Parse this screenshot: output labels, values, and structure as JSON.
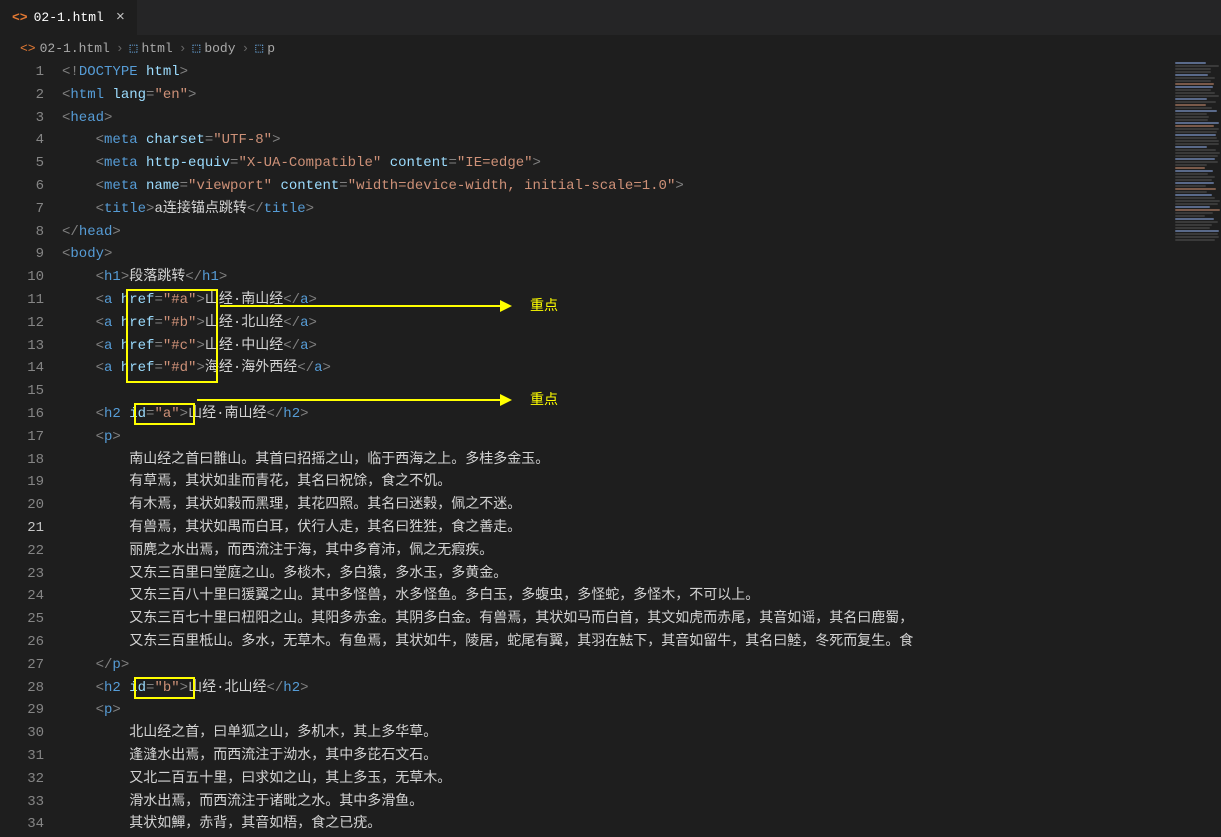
{
  "tab": {
    "filename": "02-1.html"
  },
  "breadcrumb": {
    "file": "02-1.html",
    "parts": [
      "html",
      "body",
      "p"
    ]
  },
  "annotations": {
    "label1": "重点",
    "label2": "重点"
  },
  "code_data": {
    "doctype": "<!DOCTYPE html>",
    "html_attrs": {
      "lang": "en"
    },
    "head": {
      "metas": [
        {
          "charset": "UTF-8"
        },
        {
          "http-equiv": "X-UA-Compatible",
          "content": "IE=edge"
        },
        {
          "name": "viewport",
          "content": "width=device-width, initial-scale=1.0"
        }
      ],
      "title": "a连接锚点跳转"
    },
    "body": {
      "h1": "段落跳转",
      "links": [
        {
          "href": "#a",
          "text": "山经·南山经"
        },
        {
          "href": "#b",
          "text": "山经·北山经"
        },
        {
          "href": "#c",
          "text": "山经·中山经"
        },
        {
          "href": "#d",
          "text": "海经·海外西经"
        }
      ],
      "sections": [
        {
          "id": "a",
          "h2": "山经·南山经",
          "p_lines": [
            "南山经之首曰䧿山。其首曰招摇之山，临于西海之上。多桂多金玉。",
            "有草焉，其状如韭而青花，其名曰祝馀，食之不饥。",
            "有木焉，其状如榖而黑理，其花四照。其名曰迷榖，佩之不迷。",
            "有兽焉，其状如禺而白耳，伏行人走，其名曰狌狌，食之善走。",
            "丽麂之水出焉，而西流注于海，其中多育沛，佩之无瘕疾。",
            "又东三百里曰堂庭之山。多棪木，多白猿，多水玉，多黄金。",
            "又东三百八十里曰猨翼之山。其中多怪兽，水多怪鱼。多白玉，多蝮虫，多怪蛇，多怪木，不可以上。",
            "又东三百七十里曰杻阳之山。其阳多赤金。其阴多白金。有兽焉，其状如马而白首，其文如虎而赤尾，其音如谣，其名曰鹿蜀，",
            "又东三百里柢山。多水，无草木。有鱼焉，其状如牛，陵居，蛇尾有翼，其羽在魼下，其音如留牛，其名曰鯥，冬死而复生。食"
          ]
        },
        {
          "id": "b",
          "h2": "山经·北山经",
          "p_lines": [
            "北山经之首，曰单狐之山，多机木，其上多华草。",
            "逢漨水出焉，而西流注于泑水，其中多芘石文石。",
            "又北二百五十里，曰求如之山，其上多玉，无草木。",
            "滑水出焉，而西流注于诸毗之水。其中多滑鱼。",
            "其状如鱓，赤背，其音如梧，食之已疣。"
          ]
        }
      ]
    }
  },
  "lines": [
    {
      "n": 1,
      "html": "<span class='t-gray'>&lt;!</span><span class='t-doc'>DOCTYPE</span> <span class='t-lblue'>html</span><span class='t-gray'>&gt;</span>"
    },
    {
      "n": 2,
      "html": "<span class='t-gray'>&lt;</span><span class='t-blue'>html</span> <span class='t-lblue'>lang</span><span class='t-gray'>=</span><span class='t-str'>\"en\"</span><span class='t-gray'>&gt;</span>"
    },
    {
      "n": 3,
      "html": "<span class='t-gray'>&lt;</span><span class='t-blue'>head</span><span class='t-gray'>&gt;</span>"
    },
    {
      "n": 4,
      "html": "    <span class='t-gray'>&lt;</span><span class='t-blue'>meta</span> <span class='t-lblue'>charset</span><span class='t-gray'>=</span><span class='t-str'>\"UTF-8\"</span><span class='t-gray'>&gt;</span>"
    },
    {
      "n": 5,
      "html": "    <span class='t-gray'>&lt;</span><span class='t-blue'>meta</span> <span class='t-lblue'>http-equiv</span><span class='t-gray'>=</span><span class='t-str'>\"X-UA-Compatible\"</span> <span class='t-lblue'>content</span><span class='t-gray'>=</span><span class='t-str'>\"IE=edge\"</span><span class='t-gray'>&gt;</span>"
    },
    {
      "n": 6,
      "html": "    <span class='t-gray'>&lt;</span><span class='t-blue'>meta</span> <span class='t-lblue'>name</span><span class='t-gray'>=</span><span class='t-str'>\"viewport\"</span> <span class='t-lblue'>content</span><span class='t-gray'>=</span><span class='t-str'>\"width=device-width, initial-scale=1.0\"</span><span class='t-gray'>&gt;</span>"
    },
    {
      "n": 7,
      "html": "    <span class='t-gray'>&lt;</span><span class='t-blue'>title</span><span class='t-gray'>&gt;</span><span class='t-txt'>a连接锚点跳转</span><span class='t-gray'>&lt;/</span><span class='t-blue'>title</span><span class='t-gray'>&gt;</span>"
    },
    {
      "n": 8,
      "html": "<span class='t-gray'>&lt;/</span><span class='t-blue'>head</span><span class='t-gray'>&gt;</span>"
    },
    {
      "n": 9,
      "html": "<span class='t-gray'>&lt;</span><span class='t-blue'>body</span><span class='t-gray'>&gt;</span>"
    },
    {
      "n": 10,
      "html": "    <span class='t-gray'>&lt;</span><span class='t-blue'>h1</span><span class='t-gray'>&gt;</span><span class='t-txt'>段落跳转</span><span class='t-gray'>&lt;/</span><span class='t-blue'>h1</span><span class='t-gray'>&gt;</span>"
    },
    {
      "n": 11,
      "html": "    <span class='t-gray'>&lt;</span><span class='t-blue'>a</span> <span class='t-lblue'>href</span><span class='t-gray'>=</span><span class='t-str'>\"#a\"</span><span class='t-gray'>&gt;</span><span class='t-txt'>山经·南山经</span><span class='t-gray'>&lt;/</span><span class='t-blue'>a</span><span class='t-gray'>&gt;</span>"
    },
    {
      "n": 12,
      "html": "    <span class='t-gray'>&lt;</span><span class='t-blue'>a</span> <span class='t-lblue'>href</span><span class='t-gray'>=</span><span class='t-str'>\"#b\"</span><span class='t-gray'>&gt;</span><span class='t-txt'>山经·北山经</span><span class='t-gray'>&lt;/</span><span class='t-blue'>a</span><span class='t-gray'>&gt;</span>"
    },
    {
      "n": 13,
      "html": "    <span class='t-gray'>&lt;</span><span class='t-blue'>a</span> <span class='t-lblue'>href</span><span class='t-gray'>=</span><span class='t-str'>\"#c\"</span><span class='t-gray'>&gt;</span><span class='t-txt'>山经·中山经</span><span class='t-gray'>&lt;/</span><span class='t-blue'>a</span><span class='t-gray'>&gt;</span>"
    },
    {
      "n": 14,
      "html": "    <span class='t-gray'>&lt;</span><span class='t-blue'>a</span> <span class='t-lblue'>href</span><span class='t-gray'>=</span><span class='t-str'>\"#d\"</span><span class='t-gray'>&gt;</span><span class='t-txt'>海经·海外西经</span><span class='t-gray'>&lt;/</span><span class='t-blue'>a</span><span class='t-gray'>&gt;</span>"
    },
    {
      "n": 15,
      "html": ""
    },
    {
      "n": 16,
      "html": "    <span class='t-gray'>&lt;</span><span class='t-blue'>h2</span> <span class='t-lblue'>id</span><span class='t-gray'>=</span><span class='t-str'>\"a\"</span><span class='t-gray'>&gt;</span><span class='t-txt'>山经·南山经</span><span class='t-gray'>&lt;/</span><span class='t-blue'>h2</span><span class='t-gray'>&gt;</span>"
    },
    {
      "n": 17,
      "html": "    <span class='t-gray'>&lt;</span><span class='t-blue'>p</span><span class='t-gray'>&gt;</span>"
    },
    {
      "n": 18,
      "html": "        <span class='t-txt'>南山经之首曰䧿山。其首曰招摇之山，临于西海之上。多桂多金玉。</span>"
    },
    {
      "n": 19,
      "html": "        <span class='t-txt'>有草焉，其状如韭而青花，其名曰祝馀，食之不饥。</span>"
    },
    {
      "n": 20,
      "html": "        <span class='t-txt'>有木焉，其状如榖而黑理，其花四照。其名曰迷榖，佩之不迷。</span>"
    },
    {
      "n": 21,
      "active": true,
      "html": "        <span class='t-txt'>有兽焉，其状如禺而白耳，伏行人走，其名曰狌狌，食之善走。</span>"
    },
    {
      "n": 22,
      "html": "        <span class='t-txt'>丽麂之水出焉，而西流注于海，其中多育沛，佩之无瘕疾。</span>"
    },
    {
      "n": 23,
      "html": "        <span class='t-txt'>又东三百里曰堂庭之山。多棪木，多白猿，多水玉，多黄金。</span>"
    },
    {
      "n": 24,
      "html": "        <span class='t-txt'>又东三百八十里曰猨翼之山。其中多怪兽，水多怪鱼。多白玉，多蝮虫，多怪蛇，多怪木，不可以上。</span>"
    },
    {
      "n": 25,
      "html": "        <span class='t-txt'>又东三百七十里曰杻阳之山。其阳多赤金。其阴多白金。有兽焉，其状如马而白首，其文如虎而赤尾，其音如谣，其名曰鹿蜀，</span>"
    },
    {
      "n": 26,
      "html": "        <span class='t-txt'>又东三百里柢山。多水，无草木。有鱼焉，其状如牛，陵居，蛇尾有翼，其羽在魼下，其音如留牛，其名曰鯥，冬死而复生。食</span>"
    },
    {
      "n": 27,
      "html": "    <span class='t-gray'>&lt;/</span><span class='t-blue'>p</span><span class='t-gray'>&gt;</span>"
    },
    {
      "n": 28,
      "html": "    <span class='t-gray'>&lt;</span><span class='t-blue'>h2</span> <span class='t-lblue'>id</span><span class='t-gray'>=</span><span class='t-str'>\"b\"</span><span class='t-gray'>&gt;</span><span class='t-txt'>山经·北山经</span><span class='t-gray'>&lt;/</span><span class='t-blue'>h2</span><span class='t-gray'>&gt;</span>"
    },
    {
      "n": 29,
      "html": "    <span class='t-gray'>&lt;</span><span class='t-blue'>p</span><span class='t-gray'>&gt;</span>"
    },
    {
      "n": 30,
      "html": "        <span class='t-txt'>北山经之首，曰单狐之山，多机木，其上多华草。</span>"
    },
    {
      "n": 31,
      "html": "        <span class='t-txt'>逢漨水出焉，而西流注于泑水，其中多芘石文石。</span>"
    },
    {
      "n": 32,
      "html": "        <span class='t-txt'>又北二百五十里，曰求如之山，其上多玉，无草木。</span>"
    },
    {
      "n": 33,
      "html": "        <span class='t-txt'>滑水出焉，而西流注于诸毗之水。其中多滑鱼。</span>"
    },
    {
      "n": 34,
      "html": "        <span class='t-txt'>其状如鱓，赤背，其音如梧，食之已疣。</span>"
    }
  ]
}
